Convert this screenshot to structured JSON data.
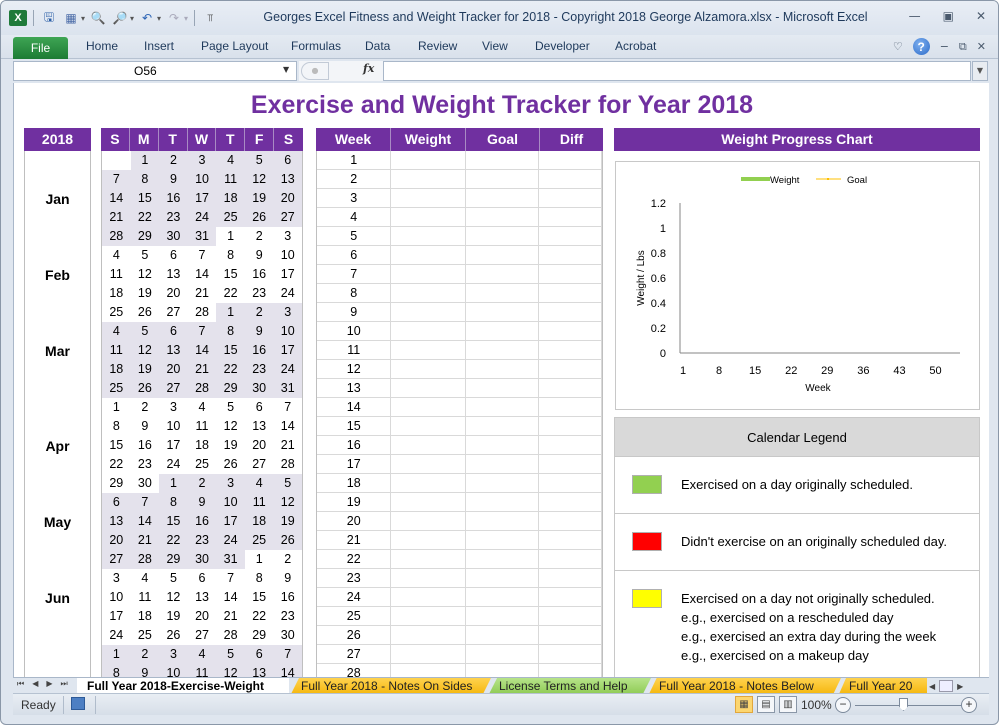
{
  "window": {
    "title": "Georges Excel Fitness and Weight Tracker for 2018 - Copyright 2018 George Alzamora.xlsx  -  Microsoft Excel",
    "controls": [
      "minimize",
      "restore",
      "close"
    ]
  },
  "quick_access": {
    "app_icon": "X",
    "icons": [
      "save-icon",
      "calculator-icon",
      "find-icon",
      "find-replace-icon",
      "undo-icon",
      "redo-icon",
      "customize-icon"
    ]
  },
  "ribbon": {
    "file_label": "File",
    "tabs": [
      "Home",
      "Insert",
      "Page Layout",
      "Formulas",
      "Data",
      "Review",
      "View",
      "Developer",
      "Acrobat"
    ],
    "help_label": "?"
  },
  "formula_bar": {
    "name_box": "O56",
    "fx_label": "fx",
    "formula_value": ""
  },
  "sheet": {
    "title": "Exercise and Weight Tracker for Year 2018",
    "year_header": "2018",
    "months": [
      "Jan",
      "Feb",
      "Mar",
      "Apr",
      "May",
      "Jun"
    ],
    "calendar": {
      "day_headers": [
        "S",
        "M",
        "T",
        "W",
        "T",
        "F",
        "S"
      ],
      "rows": [
        [
          {
            "d": "",
            "s": false
          },
          {
            "d": "1",
            "s": true
          },
          {
            "d": "2",
            "s": true
          },
          {
            "d": "3",
            "s": true
          },
          {
            "d": "4",
            "s": true
          },
          {
            "d": "5",
            "s": true
          },
          {
            "d": "6",
            "s": true
          }
        ],
        [
          {
            "d": "7",
            "s": true
          },
          {
            "d": "8",
            "s": true
          },
          {
            "d": "9",
            "s": true
          },
          {
            "d": "10",
            "s": true
          },
          {
            "d": "11",
            "s": true
          },
          {
            "d": "12",
            "s": true
          },
          {
            "d": "13",
            "s": true
          }
        ],
        [
          {
            "d": "14",
            "s": true
          },
          {
            "d": "15",
            "s": true
          },
          {
            "d": "16",
            "s": true
          },
          {
            "d": "17",
            "s": true
          },
          {
            "d": "18",
            "s": true
          },
          {
            "d": "19",
            "s": true
          },
          {
            "d": "20",
            "s": true
          }
        ],
        [
          {
            "d": "21",
            "s": true
          },
          {
            "d": "22",
            "s": true
          },
          {
            "d": "23",
            "s": true
          },
          {
            "d": "24",
            "s": true
          },
          {
            "d": "25",
            "s": true
          },
          {
            "d": "26",
            "s": true
          },
          {
            "d": "27",
            "s": true
          }
        ],
        [
          {
            "d": "28",
            "s": true
          },
          {
            "d": "29",
            "s": true
          },
          {
            "d": "30",
            "s": true
          },
          {
            "d": "31",
            "s": true
          },
          {
            "d": "1",
            "s": false
          },
          {
            "d": "2",
            "s": false
          },
          {
            "d": "3",
            "s": false
          }
        ],
        [
          {
            "d": "4",
            "s": false
          },
          {
            "d": "5",
            "s": false
          },
          {
            "d": "6",
            "s": false
          },
          {
            "d": "7",
            "s": false
          },
          {
            "d": "8",
            "s": false
          },
          {
            "d": "9",
            "s": false
          },
          {
            "d": "10",
            "s": false
          }
        ],
        [
          {
            "d": "11",
            "s": false
          },
          {
            "d": "12",
            "s": false
          },
          {
            "d": "13",
            "s": false
          },
          {
            "d": "14",
            "s": false
          },
          {
            "d": "15",
            "s": false
          },
          {
            "d": "16",
            "s": false
          },
          {
            "d": "17",
            "s": false
          }
        ],
        [
          {
            "d": "18",
            "s": false
          },
          {
            "d": "19",
            "s": false
          },
          {
            "d": "20",
            "s": false
          },
          {
            "d": "21",
            "s": false
          },
          {
            "d": "22",
            "s": false
          },
          {
            "d": "23",
            "s": false
          },
          {
            "d": "24",
            "s": false
          }
        ],
        [
          {
            "d": "25",
            "s": false
          },
          {
            "d": "26",
            "s": false
          },
          {
            "d": "27",
            "s": false
          },
          {
            "d": "28",
            "s": false
          },
          {
            "d": "1",
            "s": true
          },
          {
            "d": "2",
            "s": true
          },
          {
            "d": "3",
            "s": true
          }
        ],
        [
          {
            "d": "4",
            "s": true
          },
          {
            "d": "5",
            "s": true
          },
          {
            "d": "6",
            "s": true
          },
          {
            "d": "7",
            "s": true
          },
          {
            "d": "8",
            "s": true
          },
          {
            "d": "9",
            "s": true
          },
          {
            "d": "10",
            "s": true
          }
        ],
        [
          {
            "d": "11",
            "s": true
          },
          {
            "d": "12",
            "s": true
          },
          {
            "d": "13",
            "s": true
          },
          {
            "d": "14",
            "s": true
          },
          {
            "d": "15",
            "s": true
          },
          {
            "d": "16",
            "s": true
          },
          {
            "d": "17",
            "s": true
          }
        ],
        [
          {
            "d": "18",
            "s": true
          },
          {
            "d": "19",
            "s": true
          },
          {
            "d": "20",
            "s": true
          },
          {
            "d": "21",
            "s": true
          },
          {
            "d": "22",
            "s": true
          },
          {
            "d": "23",
            "s": true
          },
          {
            "d": "24",
            "s": true
          }
        ],
        [
          {
            "d": "25",
            "s": true
          },
          {
            "d": "26",
            "s": true
          },
          {
            "d": "27",
            "s": true
          },
          {
            "d": "28",
            "s": true
          },
          {
            "d": "29",
            "s": true
          },
          {
            "d": "30",
            "s": true
          },
          {
            "d": "31",
            "s": true
          }
        ],
        [
          {
            "d": "1",
            "s": false
          },
          {
            "d": "2",
            "s": false
          },
          {
            "d": "3",
            "s": false
          },
          {
            "d": "4",
            "s": false
          },
          {
            "d": "5",
            "s": false
          },
          {
            "d": "6",
            "s": false
          },
          {
            "d": "7",
            "s": false
          }
        ],
        [
          {
            "d": "8",
            "s": false
          },
          {
            "d": "9",
            "s": false
          },
          {
            "d": "10",
            "s": false
          },
          {
            "d": "11",
            "s": false
          },
          {
            "d": "12",
            "s": false
          },
          {
            "d": "13",
            "s": false
          },
          {
            "d": "14",
            "s": false
          }
        ],
        [
          {
            "d": "15",
            "s": false
          },
          {
            "d": "16",
            "s": false
          },
          {
            "d": "17",
            "s": false
          },
          {
            "d": "18",
            "s": false
          },
          {
            "d": "19",
            "s": false
          },
          {
            "d": "20",
            "s": false
          },
          {
            "d": "21",
            "s": false
          }
        ],
        [
          {
            "d": "22",
            "s": false
          },
          {
            "d": "23",
            "s": false
          },
          {
            "d": "24",
            "s": false
          },
          {
            "d": "25",
            "s": false
          },
          {
            "d": "26",
            "s": false
          },
          {
            "d": "27",
            "s": false
          },
          {
            "d": "28",
            "s": false
          }
        ],
        [
          {
            "d": "29",
            "s": false
          },
          {
            "d": "30",
            "s": false
          },
          {
            "d": "1",
            "s": true
          },
          {
            "d": "2",
            "s": true
          },
          {
            "d": "3",
            "s": true
          },
          {
            "d": "4",
            "s": true
          },
          {
            "d": "5",
            "s": true
          }
        ],
        [
          {
            "d": "6",
            "s": true
          },
          {
            "d": "7",
            "s": true
          },
          {
            "d": "8",
            "s": true
          },
          {
            "d": "9",
            "s": true
          },
          {
            "d": "10",
            "s": true
          },
          {
            "d": "11",
            "s": true
          },
          {
            "d": "12",
            "s": true
          }
        ],
        [
          {
            "d": "13",
            "s": true
          },
          {
            "d": "14",
            "s": true
          },
          {
            "d": "15",
            "s": true
          },
          {
            "d": "16",
            "s": true
          },
          {
            "d": "17",
            "s": true
          },
          {
            "d": "18",
            "s": true
          },
          {
            "d": "19",
            "s": true
          }
        ],
        [
          {
            "d": "20",
            "s": true
          },
          {
            "d": "21",
            "s": true
          },
          {
            "d": "22",
            "s": true
          },
          {
            "d": "23",
            "s": true
          },
          {
            "d": "24",
            "s": true
          },
          {
            "d": "25",
            "s": true
          },
          {
            "d": "26",
            "s": true
          }
        ],
        [
          {
            "d": "27",
            "s": true
          },
          {
            "d": "28",
            "s": true
          },
          {
            "d": "29",
            "s": true
          },
          {
            "d": "30",
            "s": true
          },
          {
            "d": "31",
            "s": true
          },
          {
            "d": "1",
            "s": false
          },
          {
            "d": "2",
            "s": false
          }
        ],
        [
          {
            "d": "3",
            "s": false
          },
          {
            "d": "4",
            "s": false
          },
          {
            "d": "5",
            "s": false
          },
          {
            "d": "6",
            "s": false
          },
          {
            "d": "7",
            "s": false
          },
          {
            "d": "8",
            "s": false
          },
          {
            "d": "9",
            "s": false
          }
        ],
        [
          {
            "d": "10",
            "s": false
          },
          {
            "d": "11",
            "s": false
          },
          {
            "d": "12",
            "s": false
          },
          {
            "d": "13",
            "s": false
          },
          {
            "d": "14",
            "s": false
          },
          {
            "d": "15",
            "s": false
          },
          {
            "d": "16",
            "s": false
          }
        ],
        [
          {
            "d": "17",
            "s": false
          },
          {
            "d": "18",
            "s": false
          },
          {
            "d": "19",
            "s": false
          },
          {
            "d": "20",
            "s": false
          },
          {
            "d": "21",
            "s": false
          },
          {
            "d": "22",
            "s": false
          },
          {
            "d": "23",
            "s": false
          }
        ],
        [
          {
            "d": "24",
            "s": false
          },
          {
            "d": "25",
            "s": false
          },
          {
            "d": "26",
            "s": false
          },
          {
            "d": "27",
            "s": false
          },
          {
            "d": "28",
            "s": false
          },
          {
            "d": "29",
            "s": false
          },
          {
            "d": "30",
            "s": false
          }
        ],
        [
          {
            "d": "1",
            "s": true
          },
          {
            "d": "2",
            "s": true
          },
          {
            "d": "3",
            "s": true
          },
          {
            "d": "4",
            "s": true
          },
          {
            "d": "5",
            "s": true
          },
          {
            "d": "6",
            "s": true
          },
          {
            "d": "7",
            "s": true
          }
        ],
        [
          {
            "d": "8",
            "s": true
          },
          {
            "d": "9",
            "s": true
          },
          {
            "d": "10",
            "s": true
          },
          {
            "d": "11",
            "s": true
          },
          {
            "d": "12",
            "s": true
          },
          {
            "d": "13",
            "s": true
          },
          {
            "d": "14",
            "s": true
          }
        ]
      ]
    },
    "week_table": {
      "headers": [
        "Week",
        "Weight",
        "Goal",
        "Diff"
      ],
      "weeks": [
        "1",
        "2",
        "3",
        "4",
        "5",
        "6",
        "7",
        "8",
        "9",
        "10",
        "11",
        "12",
        "13",
        "14",
        "15",
        "16",
        "17",
        "18",
        "19",
        "20",
        "21",
        "22",
        "23",
        "24",
        "25",
        "26",
        "27",
        "28"
      ],
      "weight_values": [],
      "goal_values": [],
      "diff_values": []
    },
    "chart_panel": {
      "header": "Weight Progress Chart"
    },
    "legend": {
      "header": "Calendar Legend",
      "items": [
        {
          "color": "#92d050",
          "lines": [
            "Exercised on a day originally scheduled."
          ]
        },
        {
          "color": "#ff0000",
          "lines": [
            "Didn't exercise on an originally scheduled day."
          ]
        },
        {
          "color": "#ffff00",
          "lines": [
            "Exercised on a day not originally scheduled.",
            "e.g., exercised on a rescheduled day",
            "e.g., exercised an extra day during the week",
            "e.g., exercised on a makeup day"
          ]
        }
      ]
    }
  },
  "chart_data": {
    "type": "line",
    "title": "",
    "xlabel": "Week",
    "ylabel": "Weight / Lbs",
    "x_ticks": [
      "1",
      "8",
      "15",
      "22",
      "29",
      "36",
      "43",
      "50"
    ],
    "y_ticks": [
      "0",
      "0.2",
      "0.4",
      "0.6",
      "0.8",
      "1",
      "1.2"
    ],
    "ylim": [
      0,
      1.2
    ],
    "xlim": [
      1,
      53
    ],
    "legend_position": "top",
    "series": [
      {
        "name": "Weight",
        "color": "#92d050",
        "values": []
      },
      {
        "name": "Goal",
        "color": "#ffc000",
        "values": []
      }
    ],
    "grid": false
  },
  "sheet_tabs": [
    {
      "label": "Full Year 2018-Exercise-Weight",
      "style": "active"
    },
    {
      "label": "Full Year 2018 - Notes On Sides",
      "style": "yellow"
    },
    {
      "label": "License Terms and Help",
      "style": "green"
    },
    {
      "label": "Full Year 2018 - Notes Below",
      "style": "yellow"
    },
    {
      "label": "Full Year 20",
      "style": "yellow"
    }
  ],
  "status_bar": {
    "ready_label": "Ready",
    "zoom_level": "100%",
    "zoom_percent": 100
  },
  "colors": {
    "accent_purple": "#7030a0",
    "calendar_shade": "#e4e2ec",
    "legend_header_bg": "#d9d9d9"
  }
}
